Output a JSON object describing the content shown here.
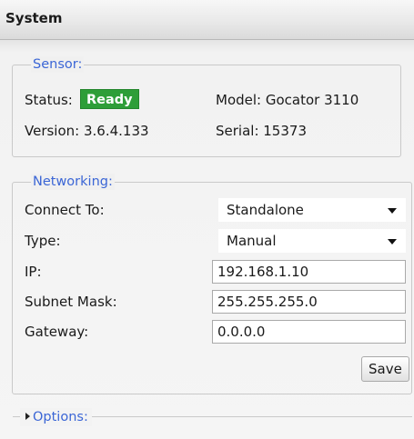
{
  "panel": {
    "title": "System"
  },
  "sensor": {
    "legend": "Sensor:",
    "status_label": "Status:",
    "status_value": "Ready",
    "status_color": "#2e9e38",
    "model_text": "Model: Gocator 3110",
    "version_text": "Version: 3.6.4.133",
    "serial_text": "Serial: 15373"
  },
  "networking": {
    "legend": "Networking:",
    "connect_to_label": "Connect To:",
    "connect_to_value": "Standalone",
    "type_label": "Type:",
    "type_value": "Manual",
    "ip_label": "IP:",
    "ip_value": "192.168.1.10",
    "subnet_label": "Subnet Mask:",
    "subnet_value": "255.255.255.0",
    "gateway_label": "Gateway:",
    "gateway_value": "0.0.0.0",
    "save_label": "Save"
  },
  "options": {
    "legend": "Options:",
    "expand_icon": "triangle-right-icon"
  },
  "colors": {
    "legend": "#3b66d6",
    "ready": "#2e9e38"
  }
}
